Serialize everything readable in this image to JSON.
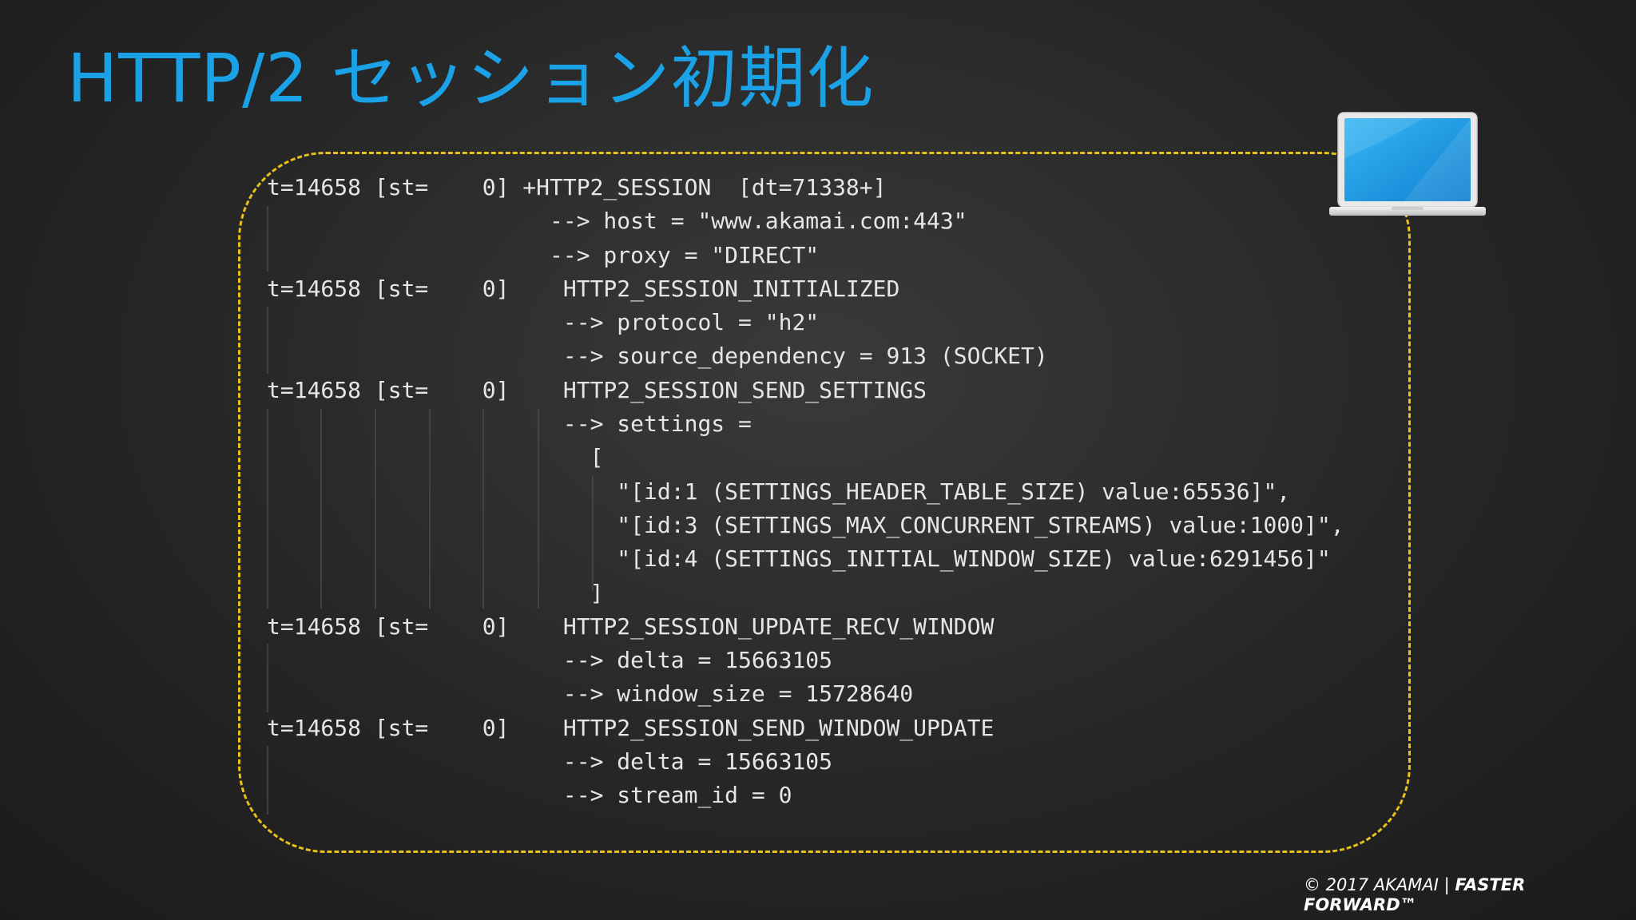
{
  "title": "HTTP/2 セッション初期化",
  "log_lines": [
    "t=14658 [st=    0] +HTTP2_SESSION  [dt=71338+]",
    "                     --> host = \"www.akamai.com:443\"",
    "                     --> proxy = \"DIRECT\"",
    "t=14658 [st=    0]    HTTP2_SESSION_INITIALIZED",
    "                      --> protocol = \"h2\"",
    "                      --> source_dependency = 913 (SOCKET)",
    "t=14658 [st=    0]    HTTP2_SESSION_SEND_SETTINGS",
    "                      --> settings =",
    "                        [",
    "                          \"[id:1 (SETTINGS_HEADER_TABLE_SIZE) value:65536]\",",
    "                          \"[id:3 (SETTINGS_MAX_CONCURRENT_STREAMS) value:1000]\",",
    "                          \"[id:4 (SETTINGS_INITIAL_WINDOW_SIZE) value:6291456]\"",
    "                        ]",
    "t=14658 [st=    0]    HTTP2_SESSION_UPDATE_RECV_WINDOW",
    "                      --> delta = 15663105",
    "                      --> window_size = 15728640",
    "t=14658 [st=    0]    HTTP2_SESSION_SEND_WINDOW_UPDATE",
    "                      --> delta = 15663105",
    "                      --> stream_id = 0"
  ],
  "footer": {
    "copyright": "© 2017 AKAMAI | ",
    "tagline_1": "FASTER",
    "tagline_2": "FORWARD™"
  },
  "icons": {
    "laptop": "laptop-icon"
  },
  "colors": {
    "title": "#1aa1e6",
    "frame": "#e8c21a",
    "text": "#e6e6e6"
  }
}
